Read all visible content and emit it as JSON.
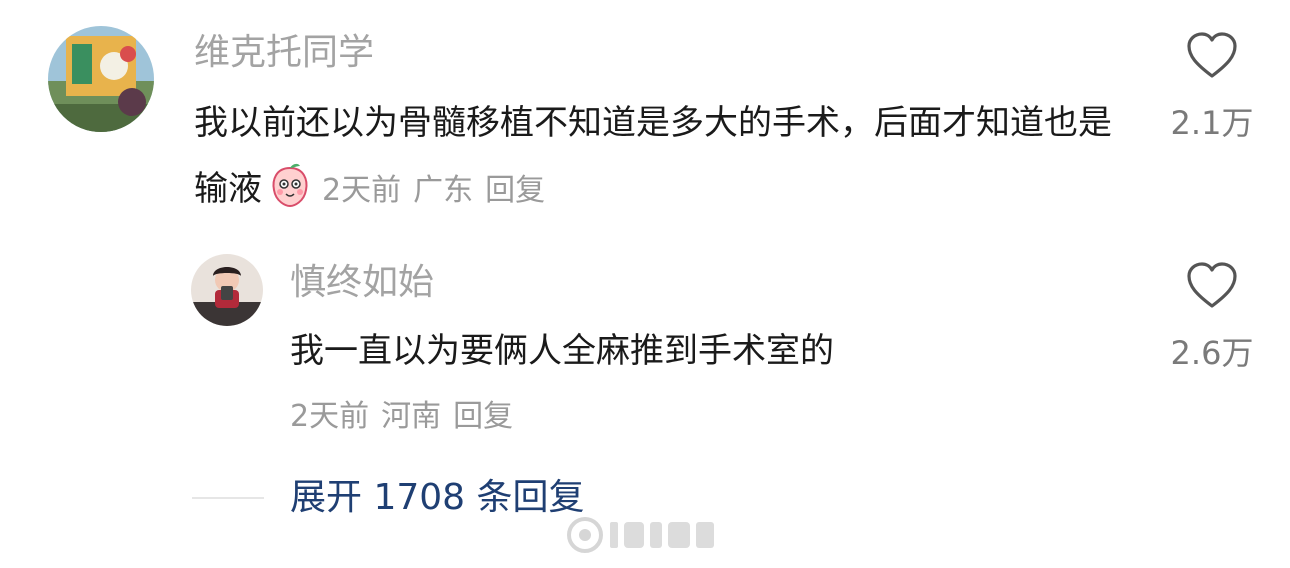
{
  "comment": {
    "username": "维克托同学",
    "text": "我以前还以为骨髓移植不知道是多大的手术，后面才知道也是输液",
    "time": "2天前",
    "location": "广东",
    "reply_label": "回复",
    "likes": "2.1万",
    "emoji": "peach-emoji"
  },
  "reply": {
    "username": "慎终如始",
    "text": "我一直以为要俩人全麻推到手术室的",
    "time": "2天前",
    "location": "河南",
    "reply_label": "回复",
    "likes": "2.6万"
  },
  "expand": {
    "label": "展开 1708 条回复"
  },
  "icons": {
    "like": "heart-outline-icon"
  },
  "colors": {
    "username": "#a3a3a3",
    "text": "#1a1a1a",
    "meta": "#9a9a9a",
    "expand": "#1f3f73"
  }
}
